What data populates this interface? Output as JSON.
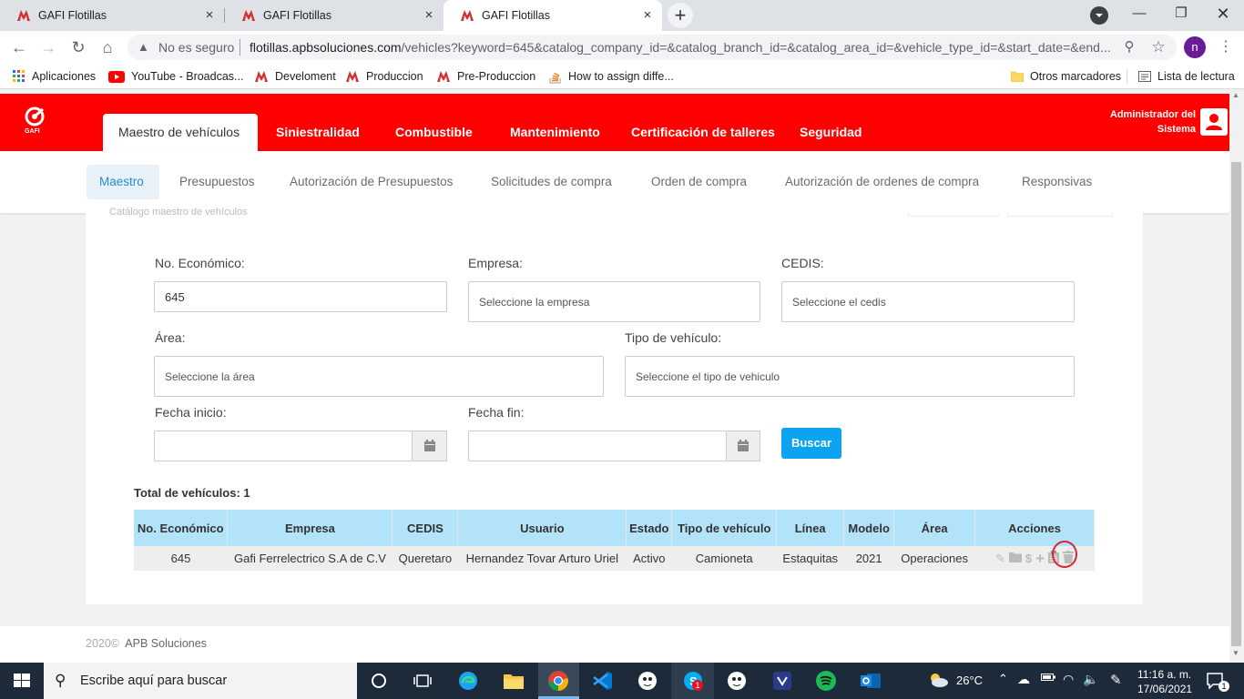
{
  "browser": {
    "tabs": [
      {
        "title": "GAFI Flotillas",
        "active": false
      },
      {
        "title": "GAFI Flotillas",
        "active": false
      },
      {
        "title": "GAFI Flotillas",
        "active": true
      }
    ],
    "security_label": "No es seguro",
    "url_host": "flotillas.apbsoluciones.com",
    "url_rest": "/vehicles?keyword=645&catalog_company_id=&catalog_branch_id=&catalog_area_id=&vehicle_type_id=&start_date=&end...",
    "profile_initial": "n",
    "bookmarks": [
      {
        "label": "Aplicaciones",
        "icon": "apps-grid-icon"
      },
      {
        "label": "YouTube - Broadcas...",
        "icon": "youtube-icon"
      },
      {
        "label": "Develoment",
        "icon": "gafi-icon"
      },
      {
        "label": "Produccion",
        "icon": "gafi-icon"
      },
      {
        "label": "Pre-Produccion",
        "icon": "gafi-icon"
      },
      {
        "label": "How to assign diffe...",
        "icon": "stackoverflow-icon"
      }
    ],
    "other_bookmarks": "Otros marcadores",
    "reading_list": "Lista de lectura"
  },
  "app": {
    "brand_colors": {
      "primary": "#ff0000",
      "accent": "#0ba3f2",
      "table_header": "#b3e3f8"
    },
    "logo_text": "GAFI",
    "top_nav": [
      {
        "label": "Maestro de vehículos",
        "active": true
      },
      {
        "label": "Siniestralidad"
      },
      {
        "label": "Combustible"
      },
      {
        "label": "Mantenimiento"
      },
      {
        "label": "Certificación de talleres"
      },
      {
        "label": "Seguridad"
      }
    ],
    "user": {
      "line1": "Administrador del",
      "line2": "Sistema"
    },
    "sub_nav": [
      {
        "label": "Maestro",
        "active": true
      },
      {
        "label": "Presupuestos"
      },
      {
        "label": "Autorización de Presupuestos"
      },
      {
        "label": "Solicitudes de compra"
      },
      {
        "label": "Orden de compra"
      },
      {
        "label": "Autorización de ordenes de compra"
      },
      {
        "label": "Responsivas"
      }
    ],
    "faded_subtitle": "Catálogo maestro de vehículos",
    "filters": {
      "economico_label": "No. Económico:",
      "economico_value": "645",
      "empresa_label": "Empresa:",
      "empresa_placeholder": "Seleccione la empresa",
      "cedis_label": "CEDIS:",
      "cedis_placeholder": "Seleccione el cedis",
      "area_label": "Área:",
      "area_placeholder": "Seleccione la área",
      "tipo_label": "Tipo de vehículo:",
      "tipo_placeholder": "Seleccione el tipo de vehiculo",
      "fecha_inicio_label": "Fecha inicio:",
      "fecha_fin_label": "Fecha fin:",
      "search_button": "Buscar"
    },
    "total_label": "Total de vehículos: 1",
    "table": {
      "headers": [
        "No. Económico",
        "Empresa",
        "CEDIS",
        "Usuario",
        "Estado",
        "Tipo de vehículo",
        "Línea",
        "Modelo",
        "Área",
        "Acciones"
      ],
      "rows": [
        [
          "645",
          "Gafi Ferrelectrico S.A de C.V",
          "Queretaro",
          "Hernandez Tovar Arturo Uriel",
          "Activo",
          "Camioneta",
          "Estaquitas",
          "2021",
          "Operaciones"
        ]
      ],
      "actions": [
        "edit-icon",
        "folder-icon",
        "dollar-icon",
        "plus-icon",
        "clipboard-icon",
        "trash-icon"
      ]
    },
    "footer_year": "2020©",
    "footer_company": "APB Soluciones"
  },
  "taskbar": {
    "search_placeholder": "Escribe aquí para buscar",
    "weather": "26°C",
    "time": "11:16 a. m.",
    "date": "17/06/2021",
    "notifications": "1",
    "skype_badge": "1"
  }
}
